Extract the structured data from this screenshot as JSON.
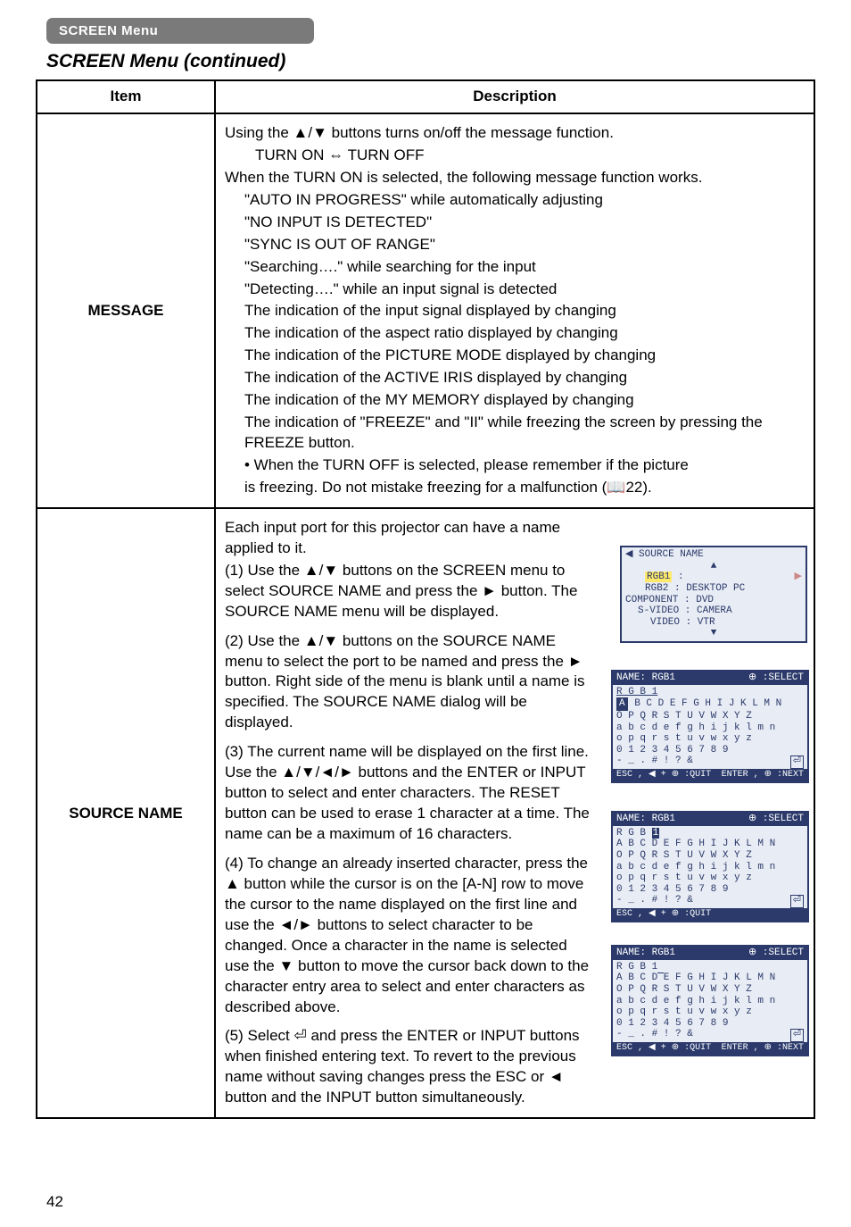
{
  "tab": "SCREEN Menu",
  "title": "SCREEN Menu (continued)",
  "head": {
    "item": "Item",
    "desc": "Description"
  },
  "message": {
    "label": "MESSAGE",
    "p1": "Using the ▲/▼ buttons turns on/off the message function.",
    "p2": "TURN ON ⇔ TURN OFF",
    "p3": "When the TURN ON is selected, the following message function works.",
    "b1": "\"AUTO IN PROGRESS\" while automatically adjusting",
    "b2": "\"NO INPUT IS DETECTED\"",
    "b3": "\"SYNC IS OUT OF RANGE\"",
    "b4": "\"Searching….\" while searching for the input",
    "b5": "\"Detecting….\" while an input signal is detected",
    "b6": "The indication of the input signal displayed by changing",
    "b7": "The indication of the aspect ratio displayed by changing",
    "b8": "The indication of the PICTURE MODE displayed by changing",
    "b9": "The indication of the ACTIVE IRIS displayed by changing",
    "b10": "The indication of the MY MEMORY displayed by changing",
    "b11": "The indication of \"FREEZE\" and \"II\" while freezing the screen by pressing the FREEZE button.",
    "b12a": "• When the TURN OFF is selected, please remember if the picture",
    "b12b": "is freezing. Do not mistake freezing for a malfunction (📖22)."
  },
  "source": {
    "label": "SOURCE NAME",
    "p0": "Each input port for this projector can have a name applied to it.",
    "p1": "(1) Use the ▲/▼ buttons on the SCREEN menu to select SOURCE NAME and press the ► button. The SOURCE NAME menu will be displayed.",
    "p2": "(2) Use the ▲/▼ buttons on the SOURCE NAME menu to select the port to be named and press the ► button. Right side of the menu is blank until a name is specified. The SOURCE NAME dialog will be displayed.",
    "p3": "(3) The current name will be displayed on the first line. Use the ▲/▼/◄/► buttons and the ENTER or INPUT button to select and enter characters. The RESET button can be used to erase 1 character at a time. The name can be a maximum of 16 characters.",
    "p4": "(4) To change an already inserted character, press the ▲ button while the cursor is on the [A-N] row to move the cursor to the name displayed on the first line and use the ◄/► buttons to select character to be changed. Once a character in the name is selected use the ▼ button to move the cursor back down to the character entry area to select and enter characters as described above.",
    "p5": "(5) Select ⏎ and press the ENTER or INPUT buttons when finished entering text. To revert to the previous name without saving changes press the ESC or ◄ button and the INPUT button simultaneously."
  },
  "osd1": {
    "title": "◀ SOURCE NAME",
    "l1a": "RGB1",
    "l1b": ":",
    "l2": "RGB2 : DESKTOP PC",
    "l3": "COMPONENT : DVD",
    "l4": "S-VIDEO : CAMERA",
    "l5": "VIDEO : VTR"
  },
  "osd_common": {
    "hdr_name": "NAME: RGB1",
    "hdr_sel": "⊕ :SELECT",
    "rows_upper": "A B C D E F G H I J K L M N",
    "rows_o": "O P Q R S T U V W X Y Z",
    "rows_lower": "a b c d e f g h i j k l m n",
    "rows_o2": "o p q r s t u v w x y z",
    "rows_num": "0 1 2 3 4 5 6 7 8 9",
    "rows_sym": "- _ . # ! ? &",
    "foot_l": "ESC , ◀ + ⊕ :QUIT",
    "foot_r": "ENTER , ⊕ :NEXT"
  },
  "osd2": {
    "name": "R G B 1",
    "hl": "A"
  },
  "osd3": {
    "name_prefix": "R G B",
    "name_hl": "1",
    "rows_upper_plain": "A B C D E F G H I J K L M N"
  },
  "osd4": {
    "name": "R G B 1"
  },
  "pagenum": "42"
}
